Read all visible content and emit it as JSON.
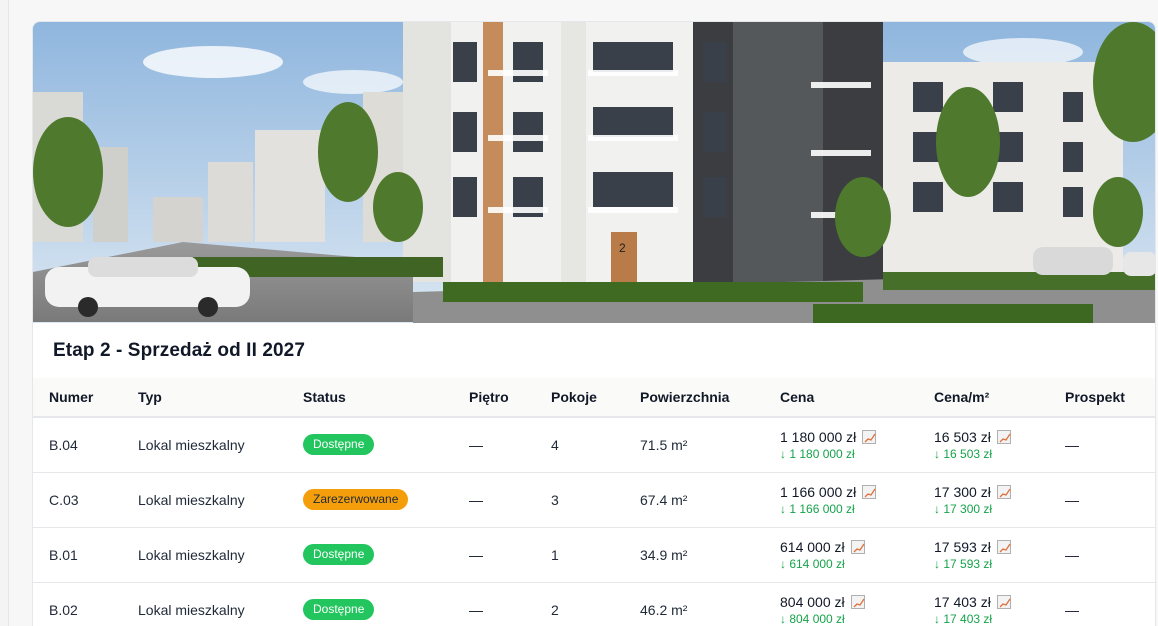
{
  "stage": {
    "title": "Etap 2 - Sprzedaż od II 2027"
  },
  "hero": {
    "alt": "building-exterior-render",
    "building_number": "2"
  },
  "table": {
    "columns": [
      "Numer",
      "Typ",
      "Status",
      "Piętro",
      "Pokoje",
      "Powierzchnia",
      "Cena",
      "Cena/m²",
      "Prospekt"
    ],
    "rows": [
      {
        "numer": "B.04",
        "typ": "Lokal mieszkalny",
        "status": "Dostępne",
        "status_color": "#22c55e",
        "pietro": "—",
        "pokoje": "4",
        "powierzchnia": "71.5 m²",
        "cena": "1 180 000 zł",
        "cena_sub": "↓ 1 180 000 zł",
        "cena_m2": "16 503 zł",
        "cena_m2_sub": "↓ 16 503 zł",
        "prospekt": "—"
      },
      {
        "numer": "C.03",
        "typ": "Lokal mieszkalny",
        "status": "Zarezerwowane",
        "status_color": "#f59e0b",
        "pietro": "—",
        "pokoje": "3",
        "powierzchnia": "67.4 m²",
        "cena": "1 166 000 zł",
        "cena_sub": "↓ 1 166 000 zł",
        "cena_m2": "17 300 zł",
        "cena_m2_sub": "↓ 17 300 zł",
        "prospekt": "—"
      },
      {
        "numer": "B.01",
        "typ": "Lokal mieszkalny",
        "status": "Dostępne",
        "status_color": "#22c55e",
        "pietro": "—",
        "pokoje": "1",
        "powierzchnia": "34.9 m²",
        "cena": "614 000 zł",
        "cena_sub": "↓ 614 000 zł",
        "cena_m2": "17 593 zł",
        "cena_m2_sub": "↓ 17 593 zł",
        "prospekt": "—"
      },
      {
        "numer": "B.02",
        "typ": "Lokal mieszkalny",
        "status": "Dostępne",
        "status_color": "#22c55e",
        "pietro": "—",
        "pokoje": "2",
        "powierzchnia": "46.2 m²",
        "cena": "804 000 zł",
        "cena_sub": "↓ 804 000 zł",
        "cena_m2": "17 403 zł",
        "cena_m2_sub": "↓ 17 403 zł",
        "prospekt": "—"
      }
    ]
  },
  "icons": {
    "price_history": "chart-line-icon"
  }
}
